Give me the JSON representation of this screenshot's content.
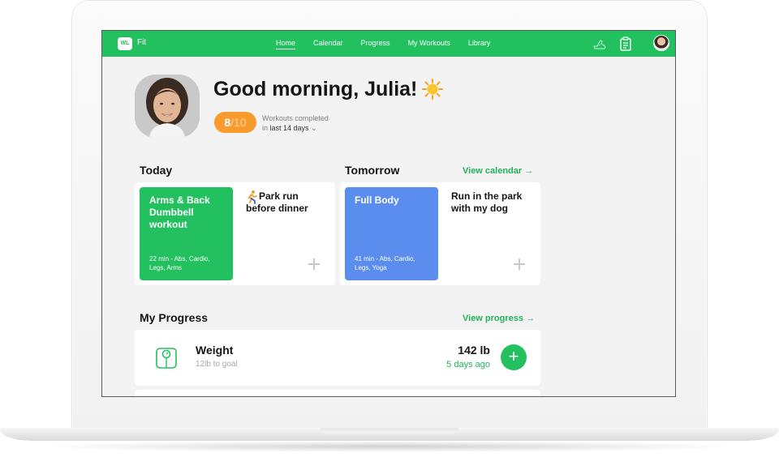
{
  "nav": {
    "logo_badge": "WL",
    "app_name": "Fit",
    "links": [
      "Home",
      "Calendar",
      "Progress",
      "My Workouts",
      "Library"
    ],
    "active_link": "Home",
    "icons": [
      "sneaker-icon",
      "clipboard-icon",
      "avatar"
    ]
  },
  "greeting": {
    "title": "Good morning, Julia!",
    "emoji_icon": "sun-icon",
    "completed": "8",
    "total": "/10",
    "label": "Workouts completed",
    "period_prefix": "in ",
    "period": "last 14 days"
  },
  "today": {
    "heading": "Today",
    "workout_title": "Arms & Back Dumbbell workout",
    "workout_meta": "22 min - Abs, Cardio, Legs, Arms",
    "note": "Park run before dinner",
    "note_icon": "runner-icon"
  },
  "tomorrow": {
    "heading": "Tomorrow",
    "link": "View calendar",
    "workout_title": "Full Body",
    "workout_meta": "41 min - Abs, Cardio, Legs, Yoga",
    "note": "Run in the park with my dog"
  },
  "progress": {
    "heading": "My Progress",
    "link": "View progress",
    "metric_label": "Weight",
    "metric_goal": "12lb to goal",
    "metric_value": "142 lb",
    "metric_updated": "5 days ago"
  },
  "colors": {
    "brand_green": "#22c05f",
    "accent_orange": "#f99a2c",
    "tile_blue": "#5b8def"
  }
}
